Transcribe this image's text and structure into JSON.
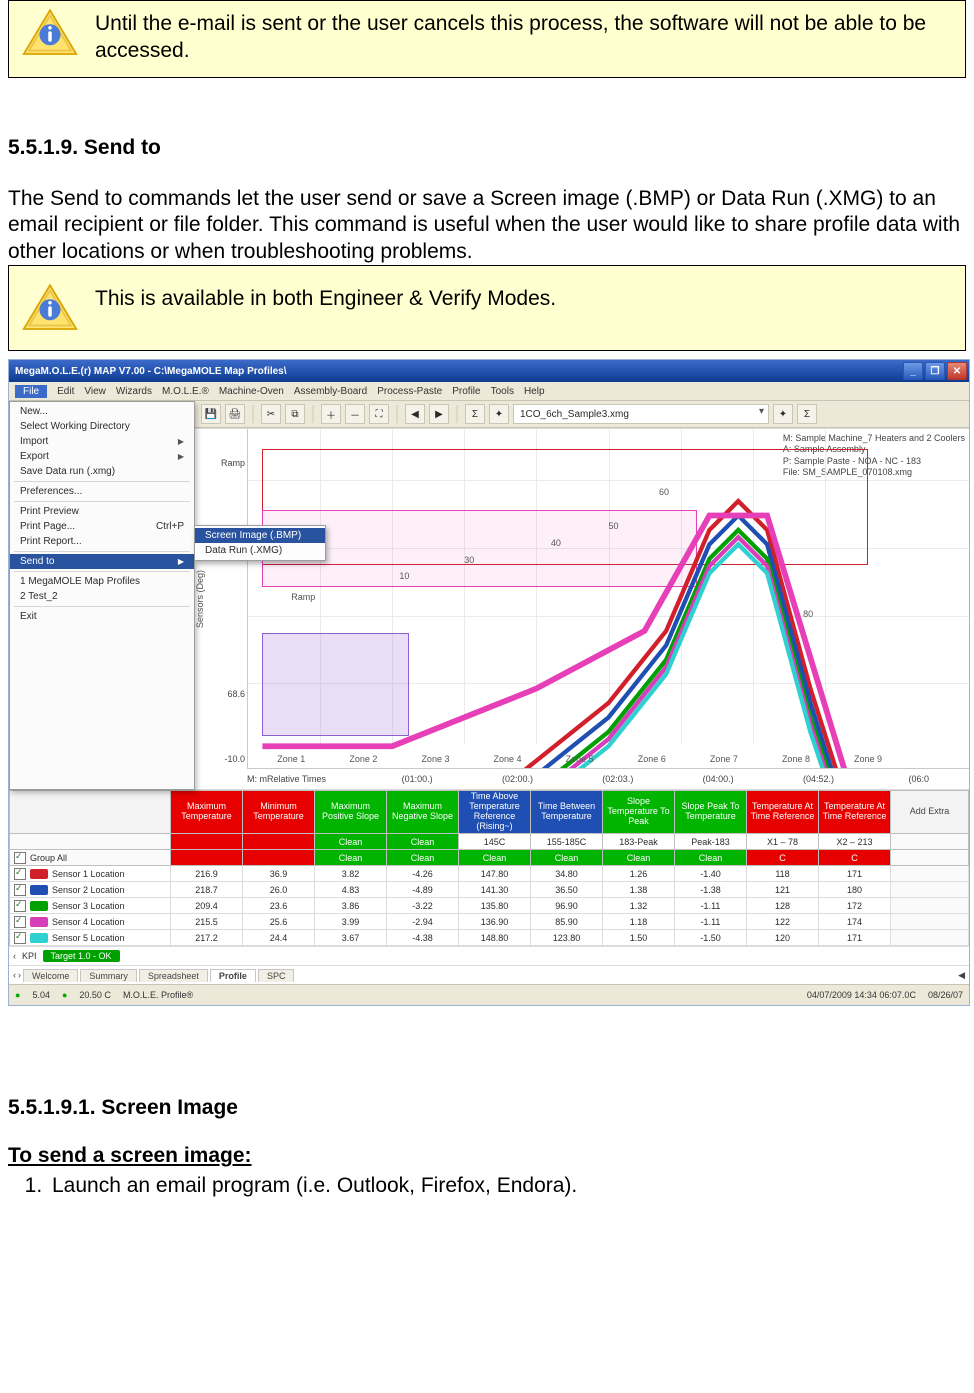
{
  "alerts": {
    "top": "Until the e-mail is sent or the user cancels this process, the software will not be able to be accessed.",
    "modes": "This is available in both Engineer & Verify Modes."
  },
  "headings": {
    "send_to": "5.5.1.9. Send to",
    "screen_image": "5.5.1.9.1. Screen Image",
    "to_send": "To send a screen image:"
  },
  "paragraphs": {
    "intro": "The Send to commands let the user send or save a Screen image (.BMP) or Data Run (.XMG) to an email recipient or file folder. This command is useful when the user would like to share profile data with other locations or when troubleshooting problems."
  },
  "steps": {
    "s1": "Launch an email program (i.e. Outlook, Firefox, Endora)."
  },
  "screenshot": {
    "title": "MegaM.O.L.E.(r) MAP V7.00 - C:\\MegaMOLE Map Profiles\\",
    "menus": [
      "File",
      "Edit",
      "View",
      "Wizards",
      "M.O.L.E.®",
      "Machine-Oven",
      "Assembly-Board",
      "Process-Paste",
      "Profile",
      "Tools",
      "Help"
    ],
    "file_menu": {
      "items": [
        {
          "label": "New...",
          "arrow": false
        },
        {
          "label": "Select Working Directory",
          "arrow": false
        },
        {
          "label": "Import",
          "arrow": true
        },
        {
          "label": "Export",
          "arrow": true
        },
        {
          "label": "Save Data run (.xmg)",
          "arrow": false
        },
        {
          "sep": true
        },
        {
          "label": "Preferences...",
          "arrow": false
        },
        {
          "sep": true
        },
        {
          "label": "Print Preview",
          "arrow": false
        },
        {
          "label": "Print Page...",
          "shortcut": "Ctrl+P",
          "arrow": false
        },
        {
          "label": "Print Report...",
          "arrow": false
        },
        {
          "sep": true
        },
        {
          "label": "Send to",
          "arrow": true,
          "selected": true
        },
        {
          "sep": true
        },
        {
          "label": "1 MegaMOLE Map Profiles",
          "arrow": false
        },
        {
          "label": "2 Test_2",
          "arrow": false
        },
        {
          "sep": true
        },
        {
          "label": "Exit",
          "arrow": false
        }
      ],
      "flyout": [
        {
          "label": "Screen Image (.BMP)",
          "selected": true
        },
        {
          "label": "Data Run (.XMG)"
        }
      ]
    },
    "toolbar_select": "1CO_6ch_Sample3.xmg",
    "chart": {
      "ylabel": "Sensors (Deg)",
      "y_ticks": {
        "top": "Ramp",
        "mid": "68.6",
        "bot": "-10.0"
      },
      "x_ticks_label": "M: mRelative Times",
      "x_ticks": [
        "(01:00.)",
        "(02:00.)",
        "(02:03.)",
        "(04:00.)",
        "(04:52.)",
        "(06:0"
      ],
      "zones": [
        "Zone 1",
        "Zone 2",
        "Zone 3",
        "Zone 4",
        "Zone 5",
        "Zone 6",
        "Zone 7",
        "Zone 8",
        "Zone 9"
      ],
      "labels": {
        "ramp": "Ramp",
        "r10": "10",
        "r30": "30",
        "r40": "40",
        "r50": "50",
        "r60": "60",
        "r80": "80"
      },
      "info_lines": [
        "M: Sample Machine_7 Heaters and 2 Coolers",
        "A: Sample Assembly",
        "P: Sample Paste - NOA - NC - 183",
        "File: SM_SAMPLE_070108.xmg"
      ]
    },
    "grid": {
      "headers": [
        {
          "cls": "lead",
          "text": ""
        },
        {
          "cls": "red",
          "text": "Maximum Temperature"
        },
        {
          "cls": "red",
          "text": "Minimum Temperature"
        },
        {
          "cls": "green",
          "text": "Maximum Positive Slope"
        },
        {
          "cls": "green",
          "text": "Maximum Negative Slope"
        },
        {
          "cls": "blue",
          "text": "Time Above Temperature Reference (Rising~)"
        },
        {
          "cls": "blue",
          "text": "Time Between Temperature"
        },
        {
          "cls": "green",
          "text": "Slope Temperature To Peak"
        },
        {
          "cls": "green",
          "text": "Slope Peak To Temperature"
        },
        {
          "cls": "red-l",
          "text": "Temperature At Time Reference"
        },
        {
          "cls": "red-l",
          "text": "Temperature At Time Reference"
        },
        {
          "cls": "addextra",
          "text": "Add Extra"
        }
      ],
      "spec": {
        "lead": "",
        "c1": "",
        "c2": "",
        "c3": "Clean",
        "c4": "Clean",
        "c5": "145C",
        "c6": "155-185C",
        "c7": "183-Peak",
        "c8": "Peak-183",
        "c9": "X1 – 78",
        "c10": "X2 – 213"
      },
      "spec2": {
        "lead": "Group All",
        "c1": "",
        "c2": "",
        "c3": "Clean",
        "c4": "Clean",
        "c5": "Clean",
        "c6": "Clean",
        "c7": "Clean",
        "c8": "Clean",
        "c9": "C",
        "c10": "C"
      },
      "rows": [
        {
          "chip": "#d11f2b",
          "name": "Sensor 1 Location",
          "v": [
            "216.9",
            "36.9",
            "3.82",
            "-4.26",
            "147.80",
            "34.80",
            "1.26",
            "-1.40",
            "118",
            "171"
          ]
        },
        {
          "chip": "#1f4fb2",
          "name": "Sensor 2 Location",
          "v": [
            "218.7",
            "26.0",
            "4.83",
            "-4.89",
            "141.30",
            "36.50",
            "1.38",
            "-1.38",
            "121",
            "180"
          ]
        },
        {
          "chip": "#00a000",
          "name": "Sensor 3 Location",
          "v": [
            "209.4",
            "23.6",
            "3.86",
            "-3.22",
            "135.80",
            "96.90",
            "1.32",
            "-1.11",
            "128",
            "172"
          ]
        },
        {
          "chip": "#d63fb7",
          "name": "Sensor 4 Location",
          "v": [
            "215.5",
            "25.6",
            "3.99",
            "-2.94",
            "136.90",
            "85.90",
            "1.18",
            "-1.11",
            "122",
            "174"
          ]
        },
        {
          "chip": "#2fd0d0",
          "name": "Sensor 5 Location",
          "v": [
            "217.2",
            "24.4",
            "3.67",
            "-4.38",
            "148.80",
            "123.80",
            "1.50",
            "-1.50",
            "120",
            "171"
          ]
        }
      ]
    },
    "kpi": {
      "label": "KPI",
      "tab": "Target 1.0 - OK"
    },
    "tabs": [
      "Welcome",
      "Summary",
      "Spreadsheet",
      "Profile",
      "SPC"
    ],
    "status": {
      "left1": "5.04",
      "left2": "20.50 C",
      "left3": "M.O.L.E. Profile®",
      "right1": "04/07/2009 14:34 06:07.0C",
      "right2": "08/26/07"
    }
  }
}
